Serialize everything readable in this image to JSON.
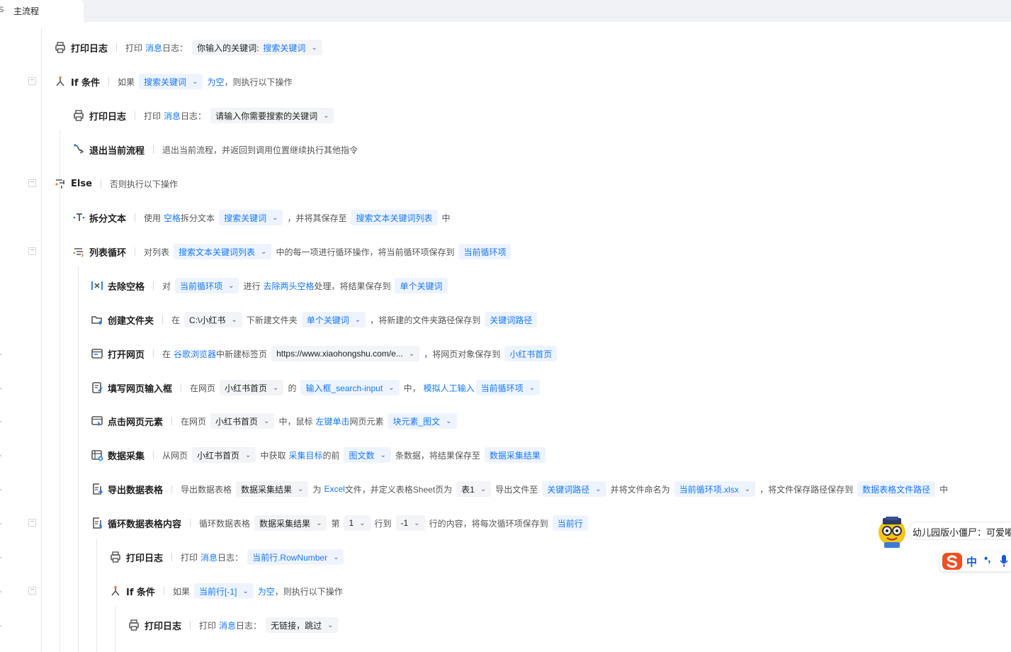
{
  "tab": {
    "label": "主流程"
  },
  "rows": [
    {
      "title": "打印日志",
      "icon": "printer-icon",
      "segments": [
        {
          "t": "seg",
          "v": "打印"
        },
        {
          "t": "link",
          "v": "消息"
        },
        {
          "t": "seg",
          "v": "日志："
        },
        {
          "t": "textchip",
          "v": "你输入的关键词:",
          "append": "搜索关键词",
          "caret": true
        }
      ]
    },
    {
      "title": "If 条件",
      "icon": "branch-icon",
      "collapse": true,
      "segments": [
        {
          "t": "seg",
          "v": "如果"
        },
        {
          "t": "chip",
          "v": "搜索关键词",
          "caret": true
        },
        {
          "t": "link",
          "v": "为空"
        },
        {
          "t": "seg",
          "v": "，则执行以下操作"
        }
      ]
    },
    {
      "title": "打印日志",
      "icon": "printer-icon",
      "segments": [
        {
          "t": "seg",
          "v": "打印"
        },
        {
          "t": "link",
          "v": "消息"
        },
        {
          "t": "seg",
          "v": "日志："
        },
        {
          "t": "textchip",
          "v": "请输入你需要搜索的关键词",
          "caret": true
        }
      ]
    },
    {
      "title": "退出当前流程",
      "icon": "exit-flow-icon",
      "segments": [
        {
          "t": "seg",
          "v": "退出当前流程，并返回到调用位置继续执行其他指令"
        }
      ]
    },
    {
      "title": "Else",
      "icon": "else-icon",
      "collapse": true,
      "segments": [
        {
          "t": "seg",
          "v": "否则执行以下操作"
        }
      ]
    },
    {
      "title": "拆分文本",
      "icon": "split-text-icon",
      "segments": [
        {
          "t": "seg",
          "v": "使用"
        },
        {
          "t": "link",
          "v": "空格"
        },
        {
          "t": "seg",
          "v": "拆分文本"
        },
        {
          "t": "chip",
          "v": "搜索关键词",
          "caret": true
        },
        {
          "t": "seg",
          "v": "，并将其保存至"
        },
        {
          "t": "chip",
          "v": "搜索文本关键词列表"
        },
        {
          "t": "seg",
          "v": "中"
        }
      ]
    },
    {
      "title": "列表循环",
      "icon": "list-loop-icon",
      "collapse": true,
      "segments": [
        {
          "t": "seg",
          "v": "对列表"
        },
        {
          "t": "chip",
          "v": "搜索文本关键词列表",
          "caret": true
        },
        {
          "t": "seg",
          "v": "中的每一项进行循环操作，将当前循环项保存到"
        },
        {
          "t": "chip",
          "v": "当前循环项"
        }
      ]
    },
    {
      "title": "去除空格",
      "icon": "trim-icon",
      "segments": [
        {
          "t": "seg",
          "v": "对"
        },
        {
          "t": "chip",
          "v": "当前循环项",
          "caret": true
        },
        {
          "t": "seg",
          "v": "进行"
        },
        {
          "t": "link",
          "v": "去除两头空格"
        },
        {
          "t": "seg",
          "v": "处理，将结果保存到"
        },
        {
          "t": "chip",
          "v": "单个关键词"
        }
      ]
    },
    {
      "title": "创建文件夹",
      "icon": "folder-add-icon",
      "segments": [
        {
          "t": "seg",
          "v": "在"
        },
        {
          "t": "textchip",
          "v": "C:\\小红书",
          "caret": true
        },
        {
          "t": "seg",
          "v": "下新建文件夹"
        },
        {
          "t": "chip",
          "v": "单个关键词",
          "caret": true
        },
        {
          "t": "seg",
          "v": "，将新建的文件夹路径保存到"
        },
        {
          "t": "chip",
          "v": "关键词路径"
        }
      ]
    },
    {
      "title": "打开网页",
      "icon": "browser-icon",
      "segments": [
        {
          "t": "seg",
          "v": "在"
        },
        {
          "t": "link",
          "v": "谷歌浏览器"
        },
        {
          "t": "seg",
          "v": "中新建标签页"
        },
        {
          "t": "textchip",
          "v": "https://www.xiaohongshu.com/e...",
          "caret": true
        },
        {
          "t": "seg",
          "v": "，将网页对象保存到"
        },
        {
          "t": "chip",
          "v": "小红书首页"
        }
      ]
    },
    {
      "title": "填写网页输入框",
      "icon": "form-fill-icon",
      "segments": [
        {
          "t": "seg",
          "v": "在网页"
        },
        {
          "t": "textchip",
          "v": "小红书首页",
          "caret": true
        },
        {
          "t": "seg",
          "v": "的"
        },
        {
          "t": "chip",
          "v": "输入框_search-input",
          "caret": true
        },
        {
          "t": "seg",
          "v": "中，"
        },
        {
          "t": "link",
          "v": "模拟人工输入"
        },
        {
          "t": "chip",
          "v": "当前循环项",
          "caret": true
        }
      ]
    },
    {
      "title": "点击网页元素",
      "icon": "click-element-icon",
      "segments": [
        {
          "t": "seg",
          "v": "在网页"
        },
        {
          "t": "textchip",
          "v": "小红书首页",
          "caret": true
        },
        {
          "t": "seg",
          "v": "中，鼠标"
        },
        {
          "t": "link",
          "v": "左键单击"
        },
        {
          "t": "seg",
          "v": "网页元素"
        },
        {
          "t": "chip",
          "v": "块元素_图文",
          "caret": true
        }
      ]
    },
    {
      "title": "数据采集",
      "icon": "data-collect-icon",
      "segments": [
        {
          "t": "seg",
          "v": "从网页"
        },
        {
          "t": "textchip",
          "v": "小红书首页",
          "caret": true
        },
        {
          "t": "seg",
          "v": "中获取"
        },
        {
          "t": "link",
          "v": "采集目标"
        },
        {
          "t": "seg",
          "v": "的前"
        },
        {
          "t": "chip",
          "v": "图文数",
          "caret": true
        },
        {
          "t": "seg",
          "v": "条数据，将结果保存至"
        },
        {
          "t": "chip",
          "v": "数据采集结果"
        }
      ]
    },
    {
      "title": "导出数据表格",
      "icon": "export-table-icon",
      "segments": [
        {
          "t": "seg",
          "v": "导出数据表格"
        },
        {
          "t": "textchip",
          "v": "数据采集结果",
          "caret": true
        },
        {
          "t": "seg",
          "v": "为"
        },
        {
          "t": "link",
          "v": "Excel"
        },
        {
          "t": "seg",
          "v": "文件，并定义表格Sheet页为"
        },
        {
          "t": "textchip",
          "v": "表1",
          "caret": true
        },
        {
          "t": "seg",
          "v": "导出文件至"
        },
        {
          "t": "chip",
          "v": "关键词路径",
          "caret": true
        },
        {
          "t": "seg",
          "v": "并将文件命名为"
        },
        {
          "t": "chip",
          "v": "当前循环项.xlsx",
          "caret": true
        },
        {
          "t": "seg",
          "v": "，将文件保存路径保存到"
        },
        {
          "t": "chip",
          "v": "数据表格文件路径"
        },
        {
          "t": "seg",
          "v": "中"
        }
      ]
    },
    {
      "title": "循环数据表格内容",
      "icon": "table-loop-icon",
      "collapse": true,
      "segments": [
        {
          "t": "seg",
          "v": "循环数据表格"
        },
        {
          "t": "textchip",
          "v": "数据采集结果",
          "caret": true
        },
        {
          "t": "seg",
          "v": "第"
        },
        {
          "t": "textchip",
          "v": "1",
          "caret": true
        },
        {
          "t": "seg",
          "v": "行到"
        },
        {
          "t": "textchip",
          "v": "-1",
          "caret": true
        },
        {
          "t": "seg",
          "v": "行的内容，将每次循环项保存到"
        },
        {
          "t": "chip",
          "v": "当前行"
        }
      ]
    },
    {
      "title": "打印日志",
      "icon": "printer-icon",
      "segments": [
        {
          "t": "seg",
          "v": "打印"
        },
        {
          "t": "link",
          "v": "消息"
        },
        {
          "t": "seg",
          "v": "日志："
        },
        {
          "t": "chip",
          "v": "当前行.RowNumber",
          "caret": true
        }
      ]
    },
    {
      "title": "If 条件",
      "icon": "branch-icon",
      "collapse": true,
      "segments": [
        {
          "t": "seg",
          "v": "如果"
        },
        {
          "t": "chip",
          "v": "当前行[-1]",
          "caret": true
        },
        {
          "t": "link",
          "v": "为空"
        },
        {
          "t": "seg",
          "v": "，则执行以下操作"
        }
      ]
    },
    {
      "title": "打印日志",
      "icon": "printer-icon",
      "segments": [
        {
          "t": "seg",
          "v": "打印"
        },
        {
          "t": "link",
          "v": "消息"
        },
        {
          "t": "seg",
          "v": "日志："
        },
        {
          "t": "textchip",
          "v": "无链接，跳过",
          "caret": true
        }
      ]
    }
  ],
  "assistant": {
    "bubble": "幼儿园版小僵尸：可爱嘟"
  },
  "ime": {
    "mode": "中",
    "punct": "•,"
  },
  "colors": {
    "accent": "#1677ff",
    "chip_bg": "#eef4ff",
    "title": "#1f1f1f"
  }
}
